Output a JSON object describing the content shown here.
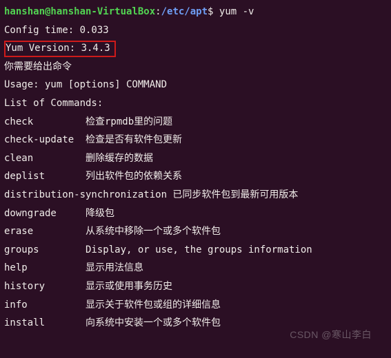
{
  "prompt": {
    "user_host": "hanshan@hanshan-VirtualBox",
    "colon": ":",
    "path": "/etc/apt",
    "dollar": "$ ",
    "command": "yum -v"
  },
  "output": {
    "config_time": "Config time: 0.033",
    "yum_version": "Yum Version: 3.4.3",
    "need_command": "你需要给出命令",
    "usage": "Usage: yum [options] COMMAND",
    "blank1": " ",
    "list_header": "List of Commands:",
    "blank2": " "
  },
  "commands": [
    {
      "name": "check",
      "desc": "检查rpmdb里的问题"
    },
    {
      "name": "check-update",
      "desc": "检查是否有软件包更新"
    },
    {
      "name": "clean",
      "desc": "删除缓存的数据"
    },
    {
      "name": "deplist",
      "desc": "列出软件包的依赖关系"
    },
    {
      "name": "distribution-synchronization",
      "desc": "已同步软件包到最新可用版本"
    },
    {
      "name": "downgrade",
      "desc": "降级包"
    },
    {
      "name": "erase",
      "desc": "从系统中移除一个或多个软件包"
    },
    {
      "name": "groups",
      "desc": "Display, or use, the groups information"
    },
    {
      "name": "help",
      "desc": "显示用法信息"
    },
    {
      "name": "history",
      "desc": "显示或使用事务历史"
    },
    {
      "name": "info",
      "desc": "显示关于软件包或组的详细信息"
    },
    {
      "name": "install",
      "desc": "向系统中安装一个或多个软件包"
    }
  ],
  "command_col_width": 14,
  "watermark": "CSDN @寒山李白"
}
